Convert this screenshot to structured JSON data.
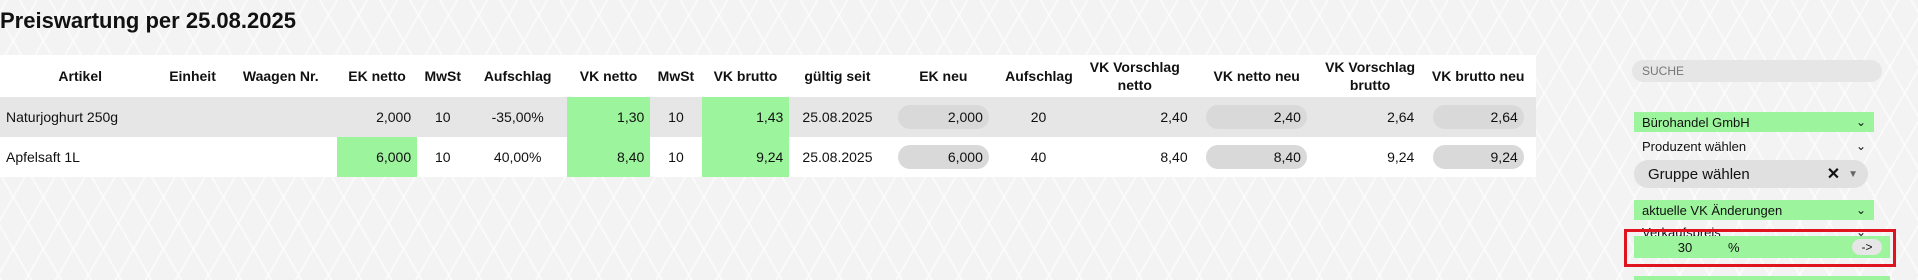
{
  "page": {
    "title": "Preiswartung per 25.08.2025"
  },
  "table": {
    "headers": [
      "Artikel",
      "Einheit",
      "Waagen Nr.",
      "EK netto",
      "MwSt",
      "Aufschlag",
      "VK netto",
      "MwSt",
      "VK brutto",
      "gültig seit",
      "EK neu",
      "Aufschlag",
      "VK Vorschlag netto",
      "VK netto neu",
      "VK Vorschlag brutto",
      "VK brutto neu"
    ],
    "rows": [
      [
        "Naturjoghurt 250g",
        "",
        "",
        "2,000",
        "10",
        "-35,00%",
        "1,30",
        "10",
        "1,43",
        "25.08.2025",
        "2,000",
        "20",
        "2,40",
        "2,40",
        "2,64",
        "2,64"
      ],
      [
        "Apfelsaft 1L",
        "",
        "",
        "6,000",
        "10",
        "40,00%",
        "8,40",
        "10",
        "9,24",
        "25.08.2025",
        "6,000",
        "40",
        "8,40",
        "8,40",
        "9,24",
        "9,24"
      ]
    ]
  },
  "panel": {
    "search_placeholder": "SUCHE",
    "supplier": "Bürohandel GmbH",
    "producer_label": "Produzent wählen",
    "group_label": "Gruppe wählen",
    "changes_label": "aktuelle VK Änderungen",
    "price_label": "Verkaufspreis",
    "percent_value": "30",
    "percent_unit": "%",
    "apply_label": "->"
  },
  "colors": {
    "accent_green": "#9cf59c",
    "highlight_red": "#e0141e"
  }
}
